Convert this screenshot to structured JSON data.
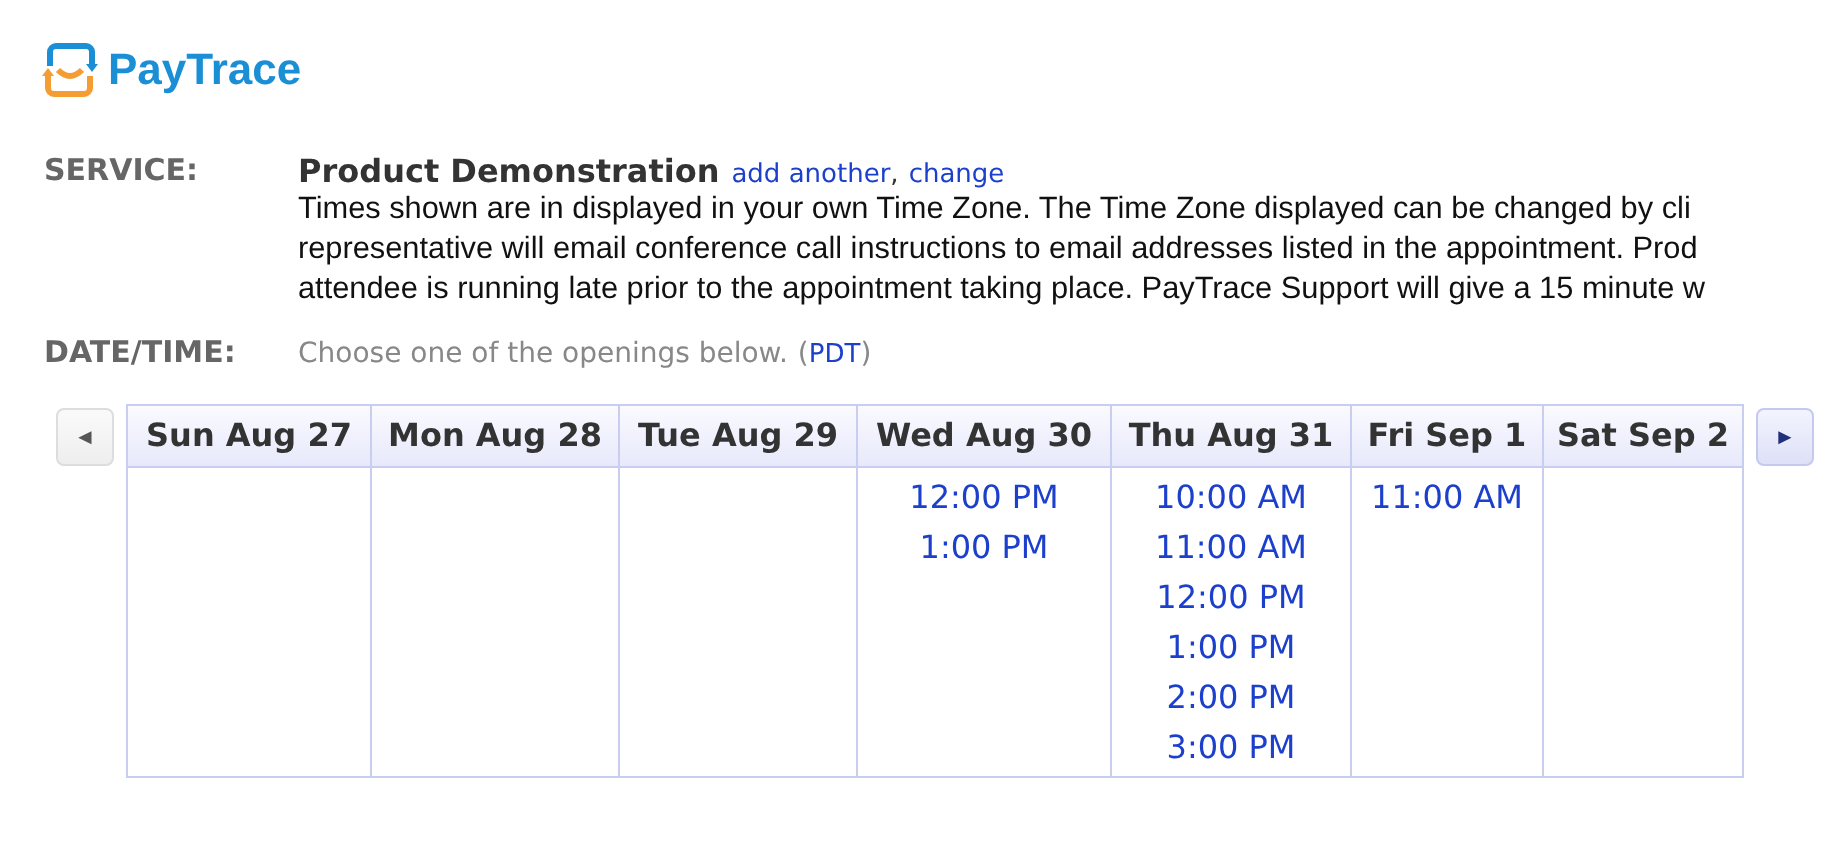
{
  "logo": {
    "name": "PayTrace"
  },
  "service": {
    "label": "SERVICE:",
    "name": "Product Demonstration",
    "links": [
      "add another",
      "change"
    ],
    "separator": ",",
    "description": [
      "Times shown are in displayed in your own Time Zone. The Time Zone displayed can be changed by cli",
      "representative will email conference call instructions to email addresses listed in the appointment. Prod",
      "attendee is running late prior to the appointment taking place. PayTrace Support will give a 15 minute w"
    ]
  },
  "datetime": {
    "label": "DATE/TIME:",
    "hint": "Choose one of the openings below.",
    "zone_open": "(",
    "zone": "PDT",
    "zone_close": ")"
  },
  "calendar": {
    "prev": "◄",
    "next": "►",
    "days": [
      {
        "label": "Sun Aug 27"
      },
      {
        "label": "Mon Aug 28"
      },
      {
        "label": "Tue Aug 29"
      },
      {
        "label": "Wed Aug 30",
        "times": [
          "12:00 PM",
          "1:00 PM"
        ]
      },
      {
        "label": "Thu Aug 31",
        "times": [
          "10:00 AM",
          "11:00 AM",
          "12:00 PM",
          "1:00 PM",
          "2:00 PM",
          "3:00 PM"
        ]
      },
      {
        "label": "Fri Sep 1",
        "times": [
          "11:00 AM"
        ]
      },
      {
        "label": "Sat Sep 2"
      }
    ]
  }
}
